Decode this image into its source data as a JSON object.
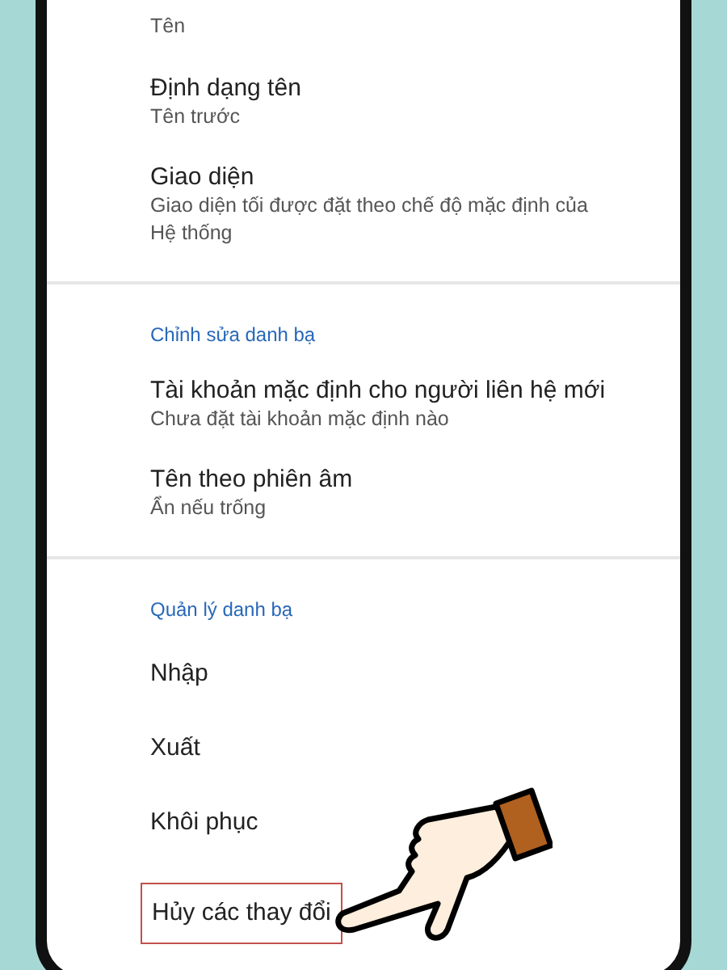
{
  "sections": [
    {
      "items": [
        {
          "subtitle": "Tên",
          "highlighted": false
        },
        {
          "title": "Định dạng tên",
          "subtitle": "Tên trước",
          "highlighted": false
        },
        {
          "title": "Giao diện",
          "subtitle": "Giao diện tối được đặt theo chế độ mặc định của Hệ thống",
          "highlighted": false
        }
      ]
    },
    {
      "header": "Chỉnh sửa danh bạ",
      "items": [
        {
          "title": "Tài khoản mặc định cho người liên hệ mới",
          "subtitle": "Chưa đặt tài khoản mặc định nào",
          "highlighted": false
        },
        {
          "title": "Tên theo phiên âm",
          "subtitle": "Ẩn nếu trống",
          "highlighted": false
        }
      ]
    },
    {
      "header": "Quản lý danh bạ",
      "items": [
        {
          "title": "Nhập",
          "highlighted": false
        },
        {
          "title": "Xuất",
          "highlighted": false
        },
        {
          "title": "Khôi phục",
          "highlighted": false
        },
        {
          "title": "Hủy các thay đổi",
          "highlighted": true
        }
      ]
    }
  ]
}
